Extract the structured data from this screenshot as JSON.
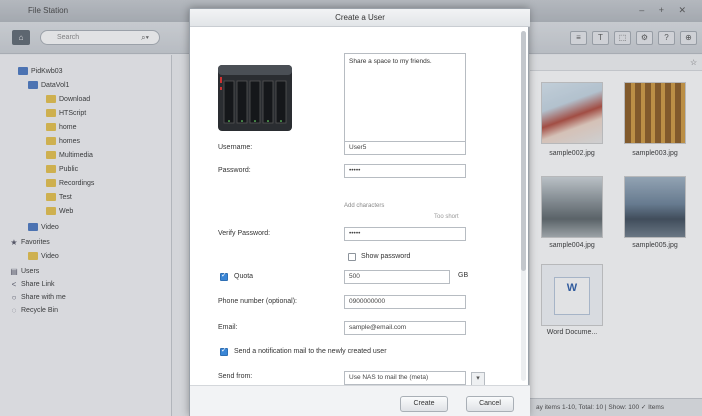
{
  "window": {
    "title": "File Station",
    "controls": "– + ✕"
  },
  "toolbar": {
    "search_placeholder": "Search",
    "home_icon": "home-icon",
    "tools": [
      "≡",
      "T",
      "⬚",
      "⚙",
      "?",
      "⊕"
    ]
  },
  "sidebar": {
    "nas_name": "PidKwb03",
    "volume": "DataVol1",
    "folders": [
      "Download",
      "HTScript",
      "home",
      "homes",
      "Multimedia",
      "Public",
      "Recordings",
      "Test",
      "Web"
    ],
    "video": "Video",
    "favorites": "Favorites",
    "favorites_video": "Video",
    "users": "Users",
    "share_link": "Share Link",
    "shared_with_me": "Share with me",
    "recycle_bin": "Recycle Bin"
  },
  "files": [
    {
      "name": "sample002.jpg"
    },
    {
      "name": "sample003.jpg"
    },
    {
      "name": "sample004.jpg"
    },
    {
      "name": "sample005.jpg"
    },
    {
      "name": "Word Docume..."
    }
  ],
  "statusbar": {
    "text": "ay items 1-10, Total: 10 | Show: 100 ✓ Items"
  },
  "dialog": {
    "title": "Create a User",
    "description": "Share a space to my friends.",
    "username_label": "Username:",
    "username_value": "User5",
    "password_label": "Password:",
    "password_value": "•••••",
    "strength_hint": "Add characters",
    "strength_value": "Too short",
    "verify_label": "Verify Password:",
    "verify_value": "•••••",
    "show_password_label": "Show password",
    "quota_label": "Quota",
    "quota_value": "500",
    "quota_unit": "GB",
    "phone_label": "Phone number (optional):",
    "phone_value": "0900000000",
    "email_label": "Email:",
    "email_value": "sample@email.com",
    "notify_label": "Send a notification mail to the newly created user",
    "send_from_label": "Send from:",
    "send_from_value": "Use NAS to mail the (meta)",
    "create_label": "Create",
    "cancel_label": "Cancel"
  },
  "colors": {
    "accent": "#3a86d6",
    "folder": "#e8c24a"
  }
}
